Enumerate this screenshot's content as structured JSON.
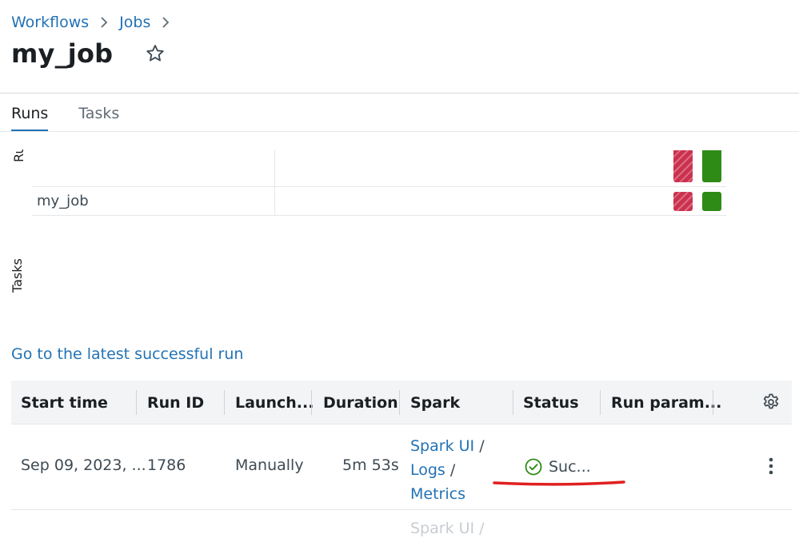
{
  "breadcrumb": {
    "items": [
      "Workflows",
      "Jobs"
    ]
  },
  "page": {
    "title": "my_job"
  },
  "tabs": [
    {
      "label": "Runs",
      "active": true
    },
    {
      "label": "Tasks",
      "active": false
    }
  ],
  "matrix": {
    "runs_axis_label": "Runs",
    "tasks_axis_label": "Tasks",
    "task_rows": [
      "my_job"
    ],
    "run_status_colors": {
      "failed": "#c9324f",
      "success": "#2e8b16"
    }
  },
  "latest_link": "Go to the latest successful run",
  "table": {
    "columns": [
      "Start time",
      "Run ID",
      "Launch...",
      "Duration",
      "Spark",
      "Status",
      "Run param..."
    ],
    "rows": [
      {
        "start_time": "Sep 09, 2023, ...",
        "run_id": "1786",
        "launched": "Manually",
        "duration": "5m 53s",
        "spark_ui": "Spark UI",
        "logs": "Logs",
        "metrics": "Metrics",
        "separator": "/",
        "status": "Suc..."
      }
    ],
    "partial_row": {
      "spark_ui": "Spark UI /"
    }
  },
  "icons": {
    "breadcrumb_separator": "chevron-right-icon",
    "favorite": "star-icon",
    "settings": "gear-icon",
    "row_menu": "kebab-icon",
    "status": "check-circle-icon"
  },
  "colors": {
    "link": "#2272b4",
    "success": "#2e8b16",
    "annotation": "#e02020"
  }
}
